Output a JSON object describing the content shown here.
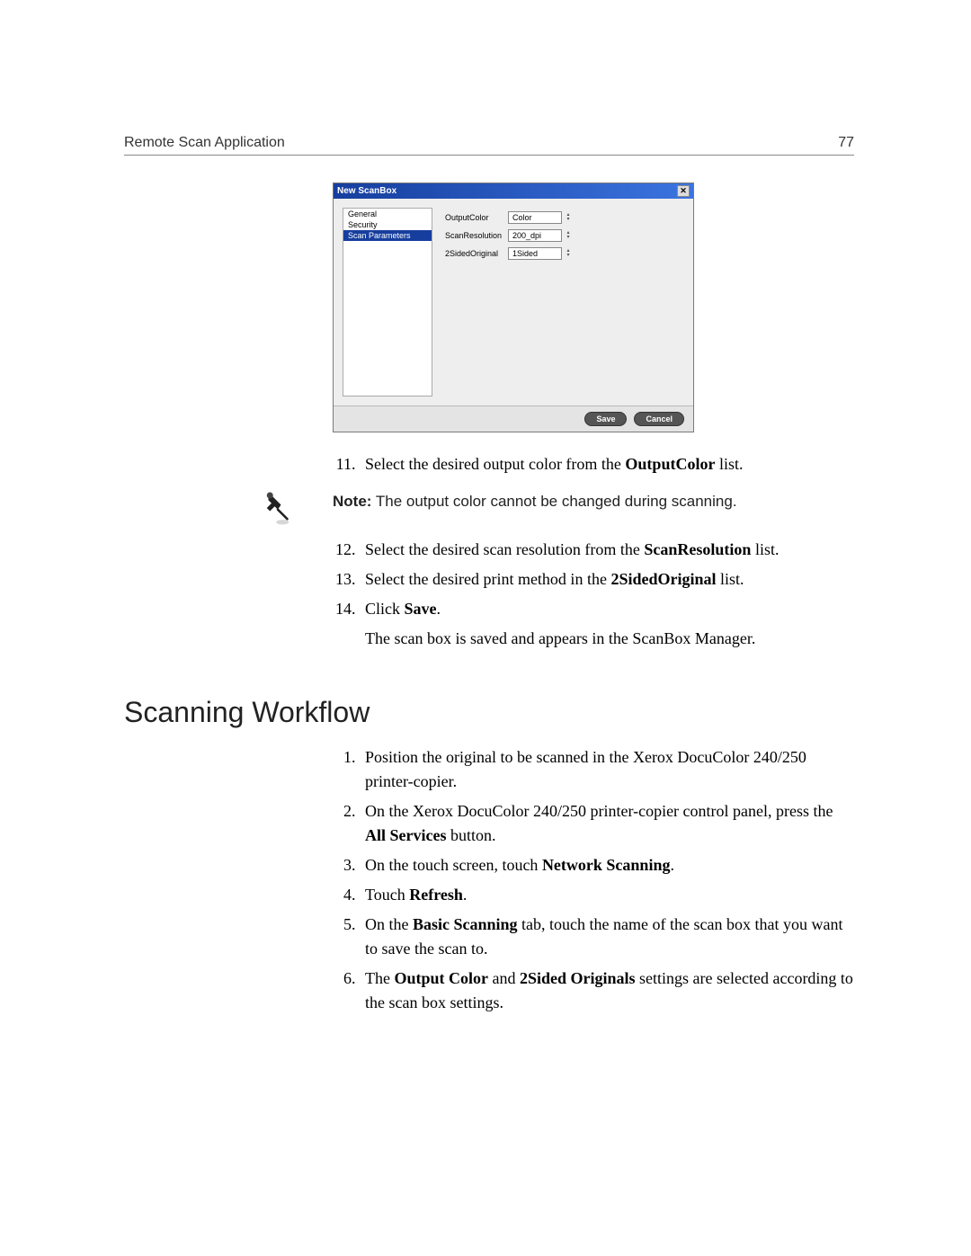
{
  "header": {
    "title": "Remote Scan Application",
    "page_number": "77"
  },
  "dialog": {
    "title": "New ScanBox",
    "sidebar": {
      "items": [
        "General",
        "Security",
        "Scan Parameters"
      ],
      "selected": 2
    },
    "params": {
      "output_color": {
        "label": "OutputColor",
        "value": "Color"
      },
      "scan_resolution": {
        "label": "ScanResolution",
        "value": "200_dpi"
      },
      "two_sided_original": {
        "label": "2SidedOriginal",
        "value": "1Sided"
      }
    },
    "buttons": {
      "save": "Save",
      "cancel": "Cancel"
    }
  },
  "steps_first": {
    "start": 11,
    "items": [
      {
        "pre": "Select the desired output color from the ",
        "bold": "OutputColor",
        "post": " list."
      }
    ]
  },
  "note": {
    "prefix": "Note:",
    "text": " The output color cannot be changed during scanning."
  },
  "steps_second": {
    "start": 12,
    "items": [
      {
        "pre": "Select the desired scan resolution from the ",
        "bold": "ScanResolution",
        "post": " list."
      },
      {
        "pre": "Select the desired print method in the ",
        "bold": "2SidedOriginal",
        "post": " list."
      },
      {
        "pre": "Click ",
        "bold": "Save",
        "post": ".",
        "sub": "The scan box is saved and appears in the ScanBox Manager."
      }
    ]
  },
  "workflow": {
    "heading": "Scanning Workflow",
    "items": [
      {
        "text": "Position the original to be scanned in the Xerox DocuColor 240/250 printer-copier."
      },
      {
        "pre": "On the Xerox DocuColor 240/250 printer-copier control panel, press the ",
        "bold": "All Services",
        "post": " button."
      },
      {
        "pre": "On the touch screen, touch ",
        "bold": "Network Scanning",
        "post": "."
      },
      {
        "pre": "Touch ",
        "bold": "Refresh",
        "post": "."
      },
      {
        "pre": "On the ",
        "bold": "Basic Scanning",
        "post": " tab, touch the name of the scan box that you want to save the scan to."
      },
      {
        "pre": "The ",
        "bold": "Output Color",
        "mid": " and ",
        "bold2": "2Sided Originals",
        "post": " settings are selected according to the scan box settings."
      }
    ]
  }
}
